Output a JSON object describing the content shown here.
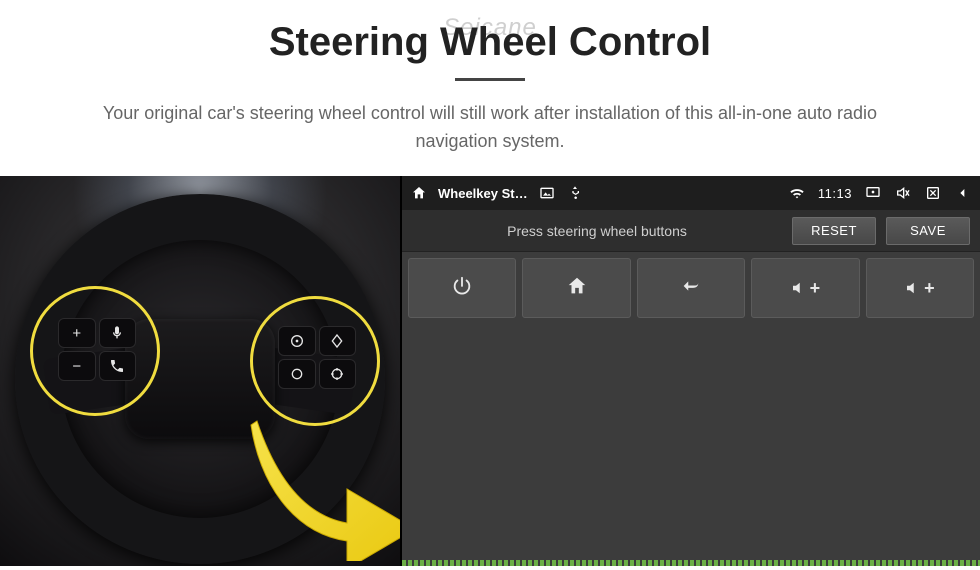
{
  "brand_watermark": "Seicane",
  "title": "Steering Wheel Control",
  "subtitle": "Your original car's steering wheel control will still work after installation of this all-in-one auto radio navigation system.",
  "wheel": {
    "left_buttons": [
      "plus",
      "voice",
      "minus",
      "phone"
    ],
    "right_buttons": [
      "disc",
      "diamond",
      "circle",
      "target"
    ]
  },
  "android_bar": {
    "app_title": "Wheelkey St…",
    "clock": "11:13"
  },
  "unit": {
    "prompt": "Press steering wheel buttons",
    "reset_label": "RESET",
    "save_label": "SAVE",
    "grid_buttons": [
      "power",
      "home",
      "back",
      "vol-up",
      "vol-up"
    ]
  }
}
